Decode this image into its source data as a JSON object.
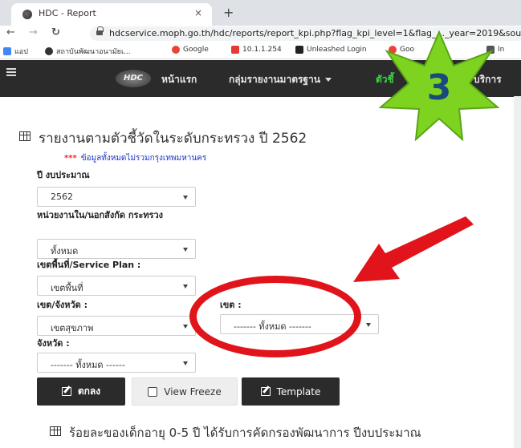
{
  "browser": {
    "tab_title": "HDC - Report",
    "tab_close": "×",
    "new_tab": "+",
    "url": "hdcservice.moph.go.th/hdc/reports/report_kpi.php?flag_kpi_level=1&flag_..._year=2019&sou",
    "bookmarks": [
      {
        "label": "แอป",
        "icon_color": "#4285f4"
      },
      {
        "label": "สถาบันพัฒนาอนามัยเ...",
        "icon_color": "#333333"
      },
      {
        "label": "Google",
        "icon_color": "#ea4335"
      },
      {
        "label": "10.1.1.254",
        "icon_color": "#e53935"
      },
      {
        "label": "Unleashed Login",
        "icon_color": "#222222"
      },
      {
        "label": "Goo",
        "icon_color": "#ea4335"
      },
      {
        "label": "In",
        "icon_color": "#555555"
      }
    ]
  },
  "navbar": {
    "logo_text": "HDC",
    "items": [
      "หน้าแรก",
      "กลุ่มรายงานมาตรฐาน",
      "ตัวชี้",
      "บริการ"
    ]
  },
  "page": {
    "title": "รายงานตามตัวชี้วัดในระดับกระทรวง ปี 2562",
    "note_stars": "***",
    "note": "ข้อมูลทั้งหมดไม่รวมกรุงเทพมหานคร",
    "fields": {
      "budget_year_label": "ปี งบประมาณ",
      "budget_year_value": "2562",
      "agency_label": "หน่วยงานใน/นอกสังกัด กระทรวง",
      "agency_value": "ทั้งหมด",
      "area_label": "เขตพื้นที่/Service Plan :",
      "area_value": "เขตพื้นที่",
      "region_label": "เขต/จังหวัด :",
      "region_value": "เขตสุขภาพ",
      "zone_label": "เขต :",
      "zone_value": "------- ทั้งหมด -------",
      "province_label": "จังหวัด :",
      "province_value": "------- ทั้งหมด ------"
    },
    "buttons": {
      "ok": "ตกลง",
      "view_freeze": "View Freeze",
      "template": "Template"
    },
    "section_title": "ร้อยละของเด็กอายุ 0-5 ปี ได้รับการคัดกรองพัฒนาการ ปีงบประมาณ"
  },
  "annotations": {
    "star_number": "3",
    "star_color": "#7ed321",
    "highlight_color": "#e0141a"
  }
}
